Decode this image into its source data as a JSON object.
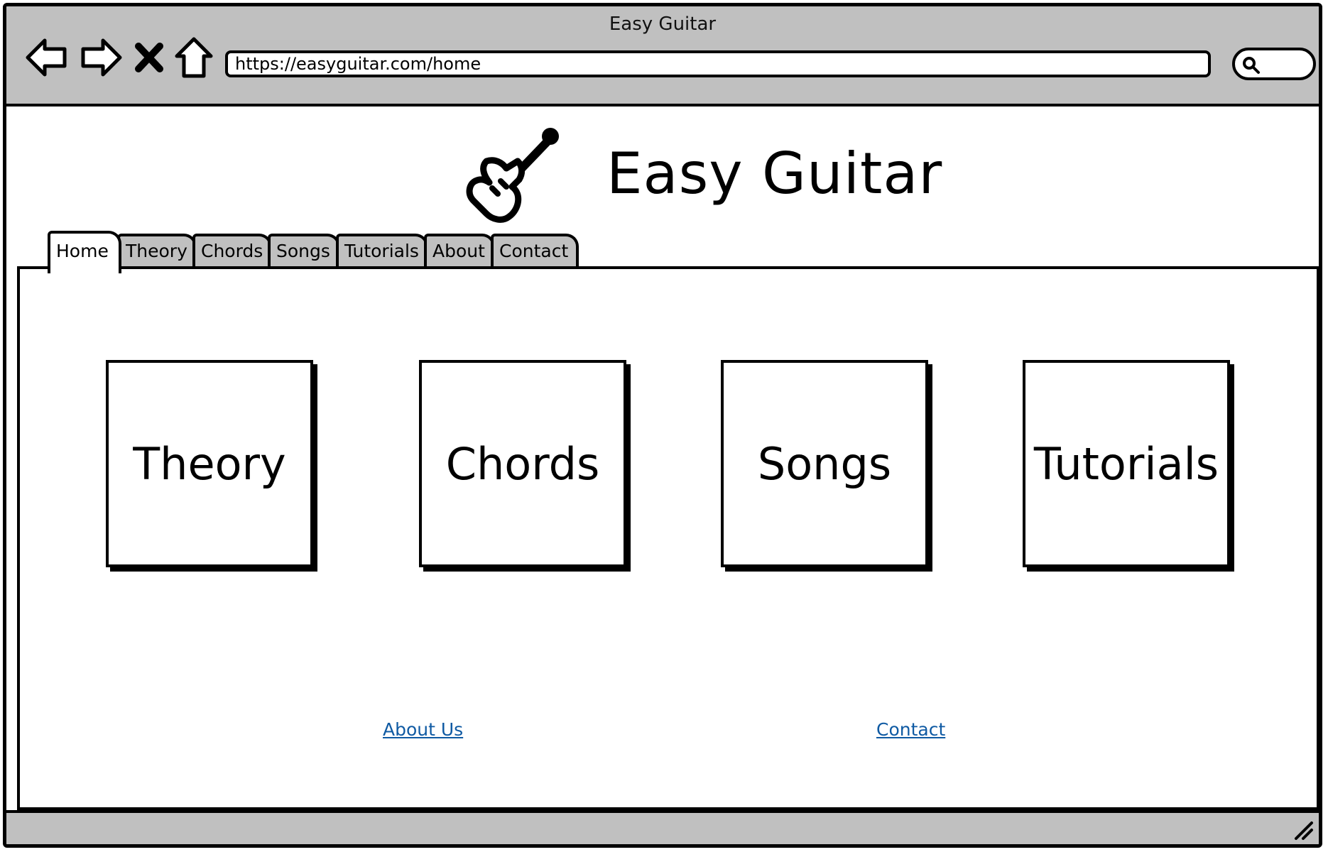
{
  "window": {
    "title": "Easy Guitar"
  },
  "toolbar": {
    "back_icon": "arrow-left-icon",
    "forward_icon": "arrow-right-icon",
    "stop_icon": "close-icon",
    "home_icon": "home-icon",
    "url": "https://easyguitar.com/home",
    "search_icon": "search-icon"
  },
  "header": {
    "logo_icon": "guitar-icon",
    "title": "Easy Guitar"
  },
  "tabs": [
    {
      "label": "Home",
      "active": true
    },
    {
      "label": "Theory",
      "active": false
    },
    {
      "label": "Chords",
      "active": false
    },
    {
      "label": "Songs",
      "active": false
    },
    {
      "label": "Tutorials",
      "active": false
    },
    {
      "label": "About",
      "active": false
    },
    {
      "label": "Contact",
      "active": false
    }
  ],
  "tiles": [
    {
      "label": "Theory"
    },
    {
      "label": "Chords"
    },
    {
      "label": "Songs"
    },
    {
      "label": "Tutorials"
    }
  ],
  "footer_links": [
    {
      "label": "About Us"
    },
    {
      "label": "Contact"
    }
  ],
  "colors": {
    "chrome": "#c0c0c0",
    "link": "#0f5aa3",
    "outline": "#000000"
  },
  "statusbar": {
    "resize_icon": "resize-grip-icon"
  }
}
